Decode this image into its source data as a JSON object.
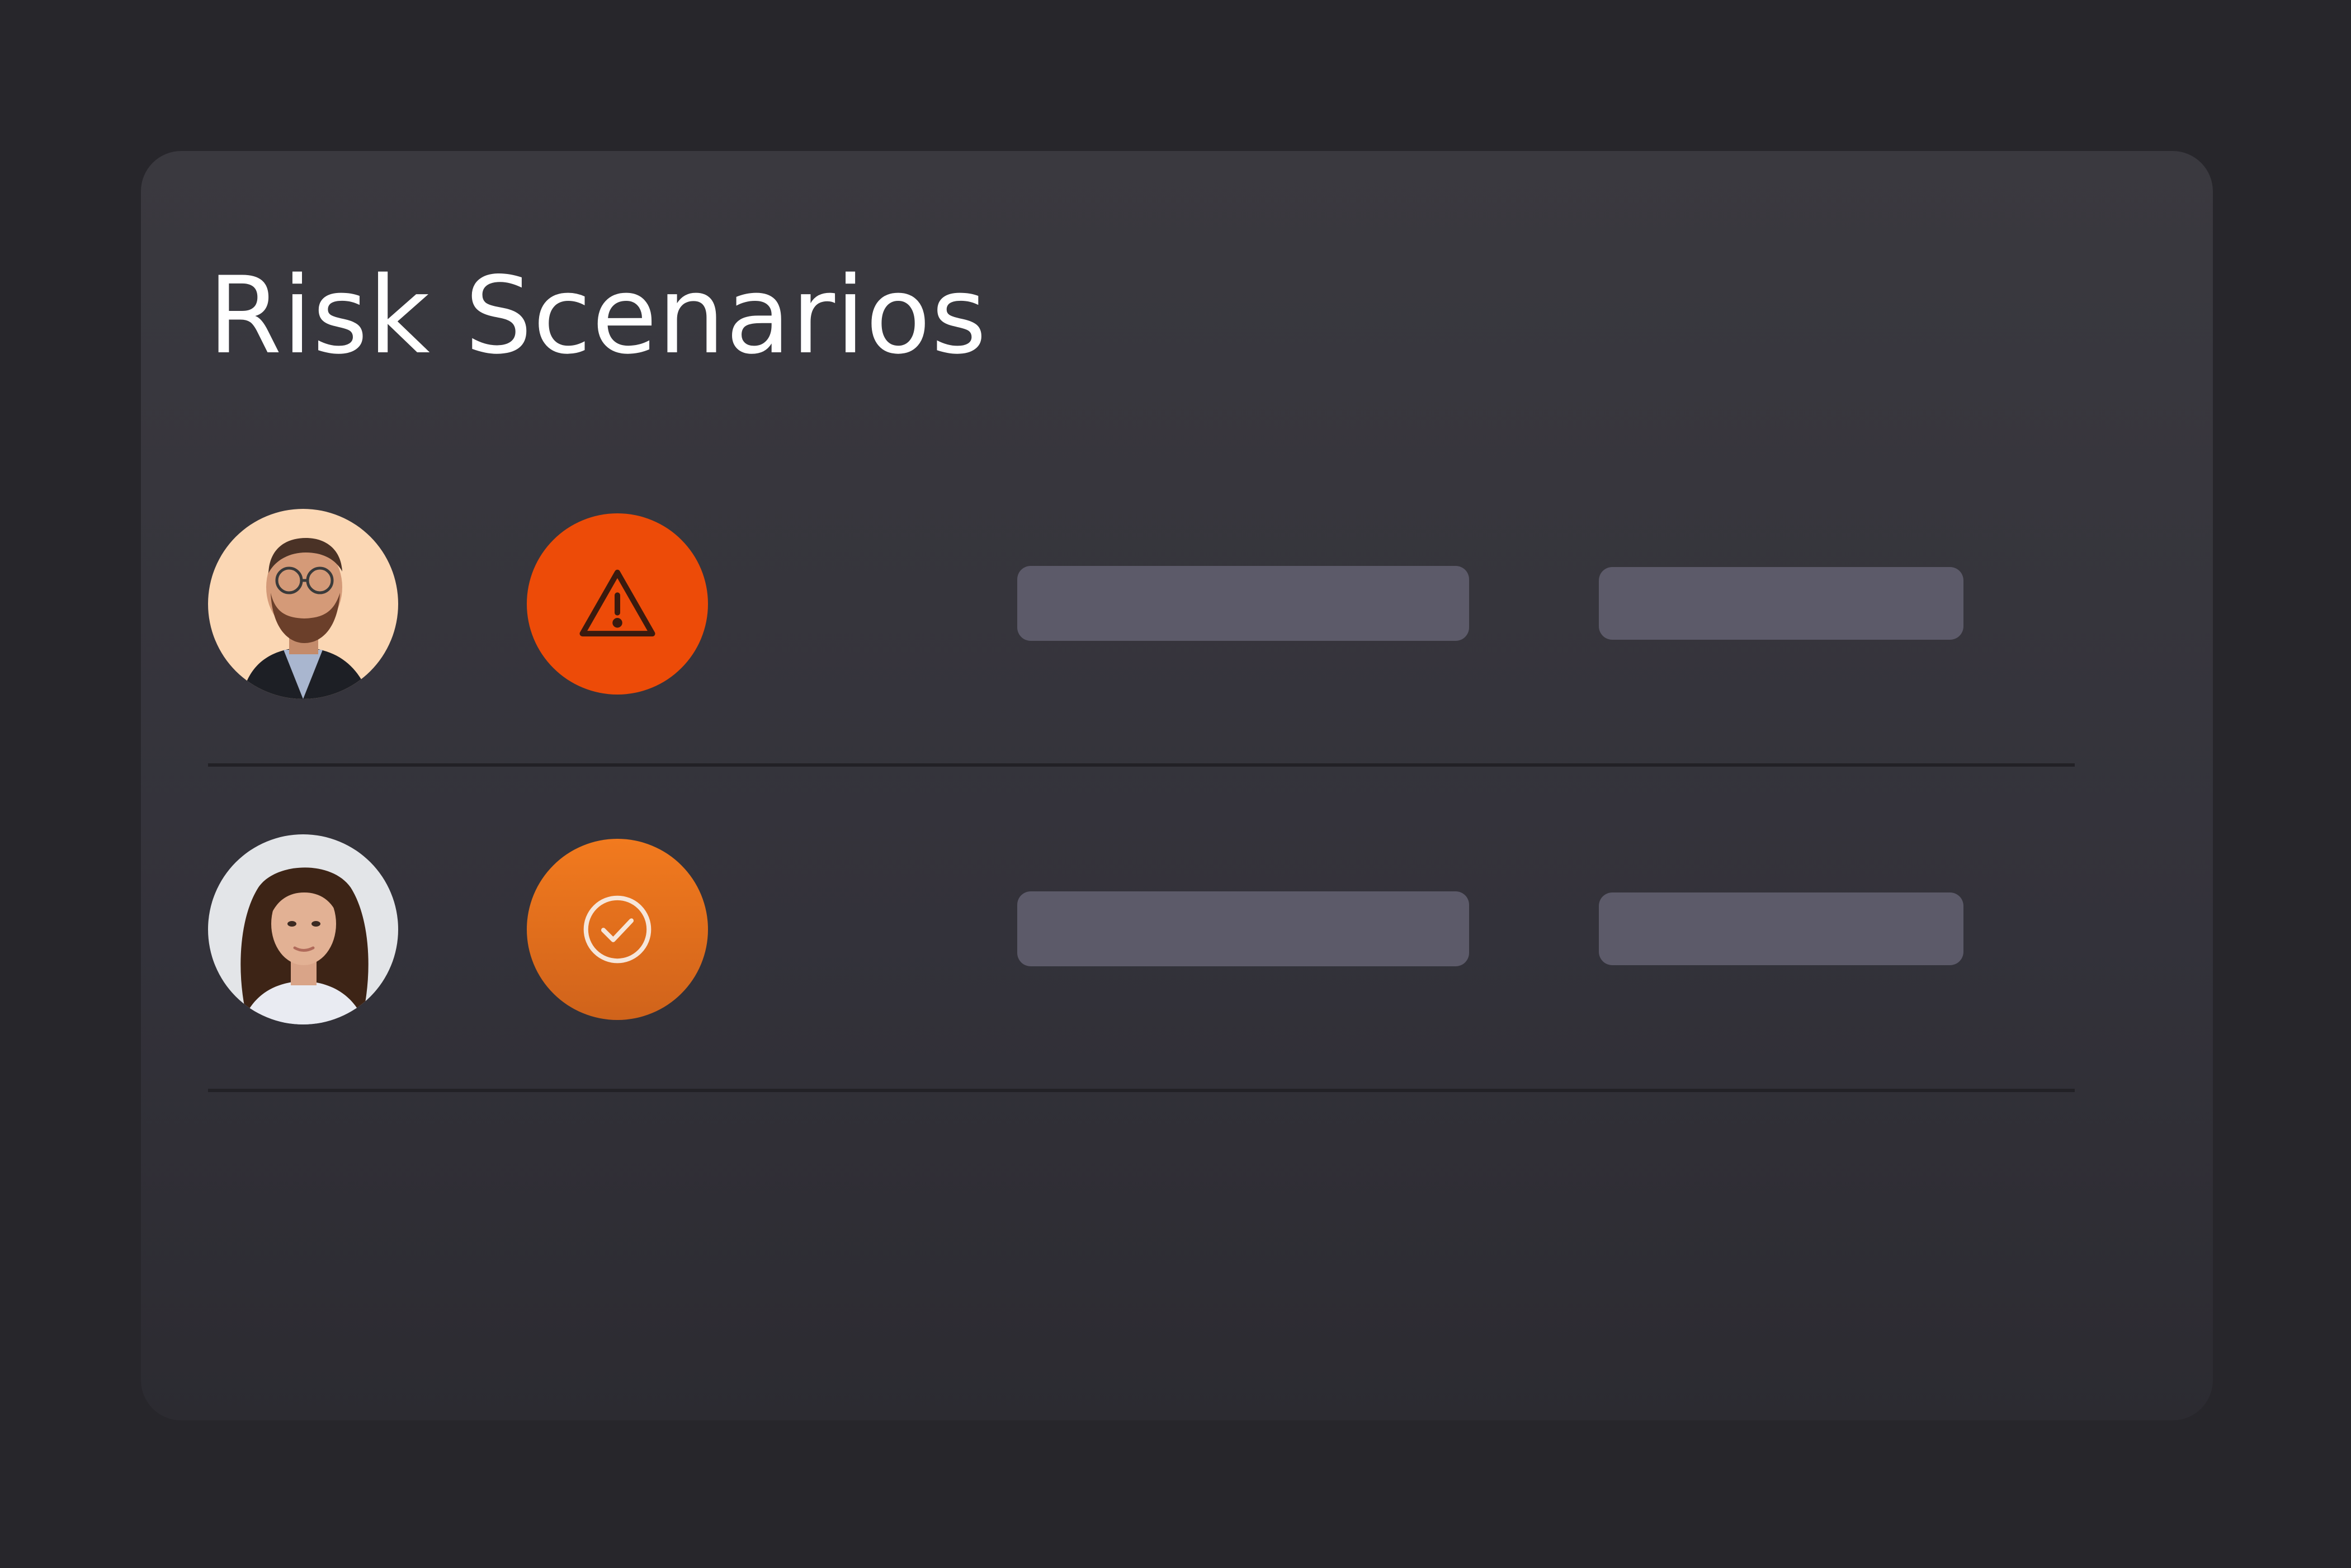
{
  "panel": {
    "title": "Risk Scenarios"
  },
  "rows": [
    {
      "avatar_icon": "person-avatar-man-icon",
      "status_icon": "warning-triangle-icon",
      "status": "warning",
      "status_color": "#ed4b08"
    },
    {
      "avatar_icon": "person-avatar-woman-icon",
      "status_icon": "check-circle-icon",
      "status": "ok",
      "status_color": "#f27a1e"
    }
  ],
  "colors": {
    "page_background": "#27262b",
    "card_background": "#3a393f",
    "placeholder_bar": "#5c5a69",
    "divider": "#222126",
    "title_text": "#ffffff"
  }
}
